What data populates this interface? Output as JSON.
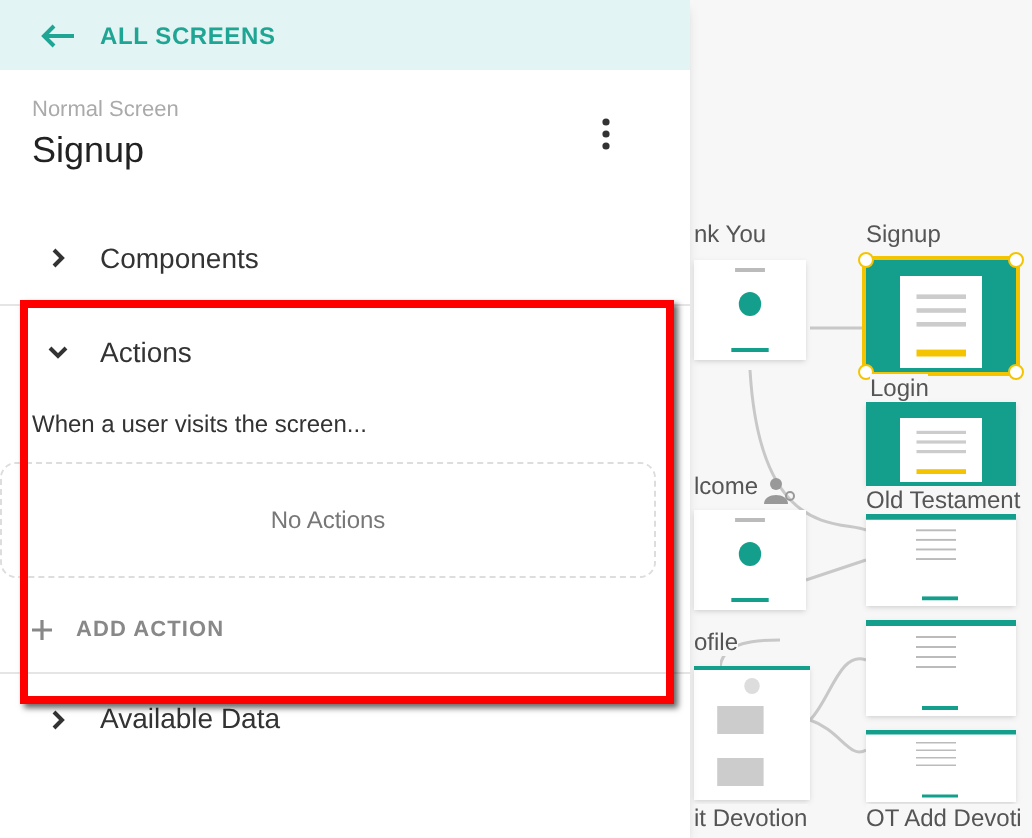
{
  "back_link": {
    "label": "ALL SCREENS"
  },
  "screen": {
    "type": "Normal Screen",
    "name": "Signup"
  },
  "sections": [
    {
      "title": "Components",
      "expanded": false
    },
    {
      "title": "Actions",
      "expanded": true,
      "trigger": "When a user visits the screen...",
      "empty_text": "No Actions",
      "add_label": "ADD ACTION"
    },
    {
      "title": "Available Data",
      "expanded": false
    }
  ],
  "canvas_screens": [
    {
      "label": "nk You",
      "kind": "white",
      "selected": false
    },
    {
      "label": "Signup",
      "kind": "teal",
      "selected": true
    },
    {
      "label": "Login",
      "kind": "teal",
      "selected": false
    },
    {
      "label": "lcome",
      "kind": "white",
      "selected": false
    },
    {
      "label": "Old Testament",
      "kind": "list",
      "selected": false
    },
    {
      "label": "ofile",
      "kind": "profile",
      "selected": false
    },
    {
      "kind": "list",
      "selected": false
    },
    {
      "label": "it Devotion",
      "kind": "none"
    },
    {
      "label": "OT Add Devoti",
      "kind": "list",
      "selected": false
    }
  ]
}
